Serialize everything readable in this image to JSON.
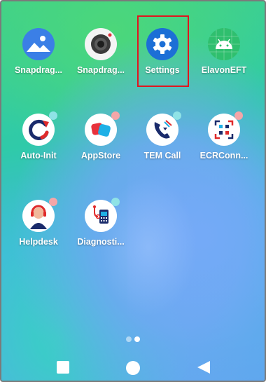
{
  "home": {
    "apps": [
      {
        "label": "Snapdrag...",
        "icon": "gallery-icon"
      },
      {
        "label": "Snapdrag...",
        "icon": "camera-icon"
      },
      {
        "label": "Settings",
        "icon": "gear-icon"
      },
      {
        "label": "ElavonEFT",
        "icon": "android-icon"
      },
      {
        "label": "Auto-Init",
        "icon": "sync-icon"
      },
      {
        "label": "AppStore",
        "icon": "store-icon"
      },
      {
        "label": "TEM Call",
        "icon": "phone-icon"
      },
      {
        "label": "ECRConn...",
        "icon": "qr-icon"
      },
      {
        "label": "Helpdesk",
        "icon": "headset-icon"
      },
      {
        "label": "Diagnosti...",
        "icon": "diagnostics-icon"
      }
    ],
    "pager": {
      "pages": 2,
      "current": 2
    }
  },
  "navbar": {
    "buttons": [
      "recents-icon",
      "home-icon",
      "back-icon"
    ]
  },
  "colors": {
    "highlight": "#e0161f",
    "gallery_bg": "#3b7fe6",
    "settings_bg": "#1c6fd6",
    "android_bg": "#2fbf6e",
    "dot_pink": "#f4a6a8",
    "dot_cyan": "#8fe3e6"
  }
}
